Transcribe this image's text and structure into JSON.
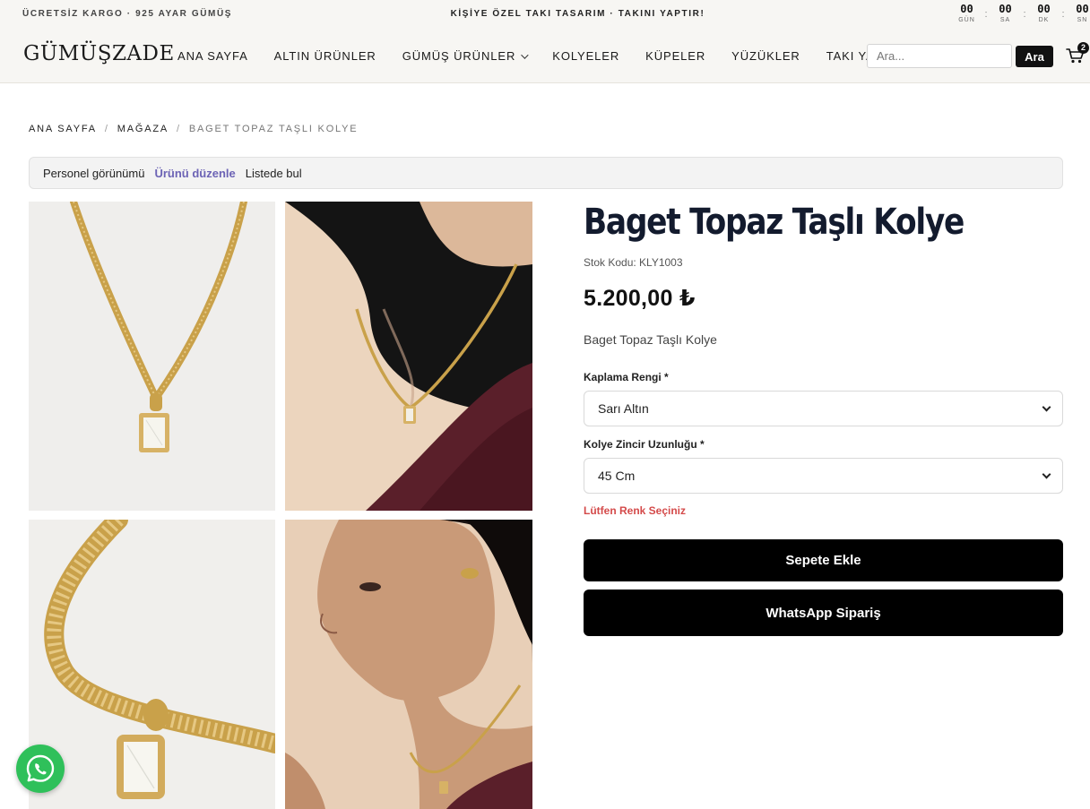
{
  "topbar": {
    "left_text": "ÜCRETSİZ KARGO · 925 AYAR GÜMÜŞ",
    "center_text": "KİŞİYE ÖZEL TAKI TASARIM · TAKINI YAPTIR!",
    "countdown": [
      {
        "value": "00",
        "label": "GÜN"
      },
      {
        "value": "00",
        "label": "SA"
      },
      {
        "value": "00",
        "label": "DK"
      },
      {
        "value": "00",
        "label": "SN"
      }
    ],
    "countdown_sep": ":"
  },
  "header": {
    "logo": "GÜMÜŞZADE",
    "nav": [
      {
        "label": "ANA SAYFA"
      },
      {
        "label": "ALTIN ÜRÜNLER"
      },
      {
        "label": "GÜMÜŞ ÜRÜNLER",
        "dropdown": true
      },
      {
        "label": "KOLYELER"
      },
      {
        "label": "KÜPELER"
      },
      {
        "label": "YÜZÜKLER"
      },
      {
        "label": "TAKI YAPTIRMA"
      }
    ],
    "search_placeholder": "Ara...",
    "search_button": "Ara",
    "cart_count": "2"
  },
  "breadcrumb": {
    "items": [
      "ANA SAYFA",
      "MAĞAZA"
    ],
    "current": "BAGET TOPAZ TAŞLI KOLYE",
    "sep": "/"
  },
  "admin_bar": {
    "staff_view": "Personel görünümü",
    "edit_product": "Ürünü düzenle",
    "find_in_list": "Listede bul"
  },
  "product": {
    "title": "Baget Topaz Taşlı Kolye",
    "sku": "Stok Kodu: KLY1003",
    "price": "5.200,00 ₺",
    "short_description": "Baget Topaz Taşlı Kolye",
    "option_color_label": "Kaplama Rengi *",
    "option_color_value": "Sarı Altın",
    "option_length_label": "Kolye Zincir Uzunluğu *",
    "option_length_value": "45 Cm",
    "warning": "Lütfen Renk Seçiniz",
    "add_to_cart": "Sepete Ekle",
    "whatsapp_order": "WhatsApp Sipariş"
  },
  "colors": {
    "accent_link": "#6c63b5",
    "warning": "#d44a4a",
    "whatsapp": "#2fc05a",
    "gold": "#c9a14a"
  }
}
